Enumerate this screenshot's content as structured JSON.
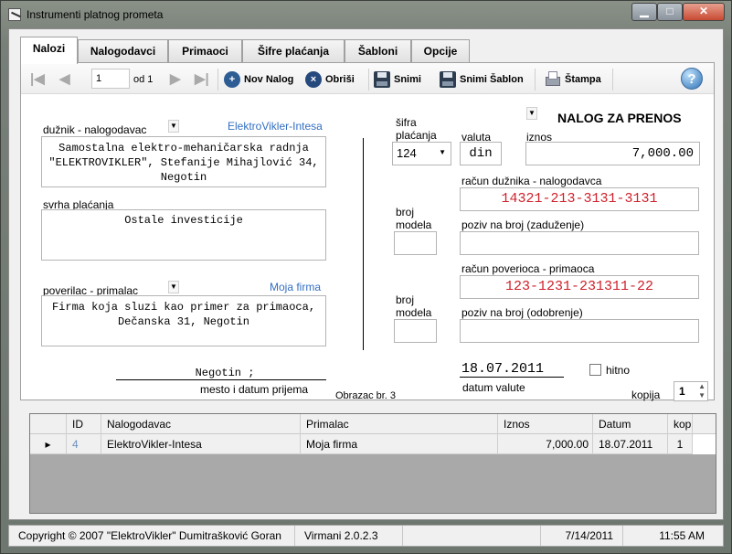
{
  "window": {
    "title": "Instrumenti platnog prometa",
    "buttons": {
      "minimize": "▁",
      "maximize": "□",
      "close": "✕"
    }
  },
  "tabs": [
    {
      "label": "Nalozi",
      "active": true
    },
    {
      "label": "Nalogodavci"
    },
    {
      "label": "Primaoci"
    },
    {
      "label": "Šifre plaćanja"
    },
    {
      "label": "Šabloni"
    },
    {
      "label": "Opcije"
    }
  ],
  "toolbar": {
    "position": "1",
    "of_label": "od 1",
    "new_label": "Nov Nalog",
    "delete_label": "Obriši",
    "save_label": "Snimi",
    "save_template_label": "Snimi Šablon",
    "print_label": "Štampa",
    "help_label": "?"
  },
  "form": {
    "payer_label": "dužnik - nalogodavac",
    "payer_link": "ElektroVikler-Intesa",
    "payer_text": "Samostalna elektro-mehaničarska radnja \"ELEKTROVIKLER\", Stefanije Mihajlović 34, Negotin",
    "purpose_label": "svrha plaćanja",
    "purpose_text": "Ostale investicije",
    "recipient_label": "poverilac - primalac",
    "recipient_link": "Moja firma",
    "recipient_text": "Firma koja sluzi kao primer za primaoca, Dečanska 31, Negotin",
    "place_date": "Negotin ;",
    "place_date_label": "mesto i datum prijema",
    "form_no": "Obrazac br. 3",
    "doc_title": "NALOG ZA PRENOS",
    "code_label": "šifra plaćanja",
    "code_value": "124",
    "currency_label": "valuta",
    "currency_value": "din",
    "amount_label": "iznos",
    "amount_value": "7,000.00",
    "debtor_account_label": "račun dužnika - nalogodavca",
    "debtor_account": "14321-213-3131-3131",
    "model_label_1": "broj modela",
    "ref_debit_label": "poziv na broj (zaduženje)",
    "creditor_account_label": "račun poverioca - primaoca",
    "creditor_account": "123-1231-231311-22",
    "model_label_2": "broj modela",
    "ref_credit_label": "poziv na broj (odobrenje)",
    "value_date": "18.07.2011",
    "value_date_label": "datum valute",
    "urgent_label": "hitno",
    "copies_label": "kopija",
    "copies_value": "1"
  },
  "grid": {
    "headers": [
      "ID",
      "Nalogodavac",
      "Primalac",
      "Iznos",
      "Datum",
      "kop"
    ],
    "rows": [
      [
        "4",
        "ElektroVikler-Intesa",
        "Moja firma",
        "7,000.00",
        "18.07.2011",
        "1"
      ]
    ]
  },
  "status": {
    "copyright": "Copyright © 2007 \"ElektroVikler\" Dumitrašković Goran",
    "version": "Virmani 2.0.2.3",
    "date": "7/14/2011",
    "time": "11:55 AM"
  }
}
